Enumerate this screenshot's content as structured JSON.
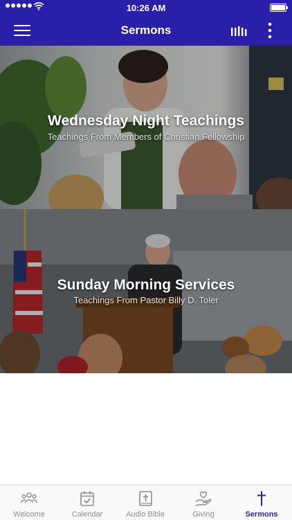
{
  "status_bar": {
    "time": "10:26 AM"
  },
  "header": {
    "title": "Sermons"
  },
  "cards": [
    {
      "title": "Wednesday Night Teachings",
      "subtitle": "Teachings From Members of Christian Fellowship"
    },
    {
      "title": "Sunday Morning Services",
      "subtitle": "Teachings From Pastor Billy D. Toler"
    }
  ],
  "tabs": [
    {
      "label": "Welcome",
      "icon": "people-icon"
    },
    {
      "label": "Calendar",
      "icon": "calendar-check-icon"
    },
    {
      "label": "Audio Bible",
      "icon": "bible-icon"
    },
    {
      "label": "Giving",
      "icon": "hand-heart-icon"
    },
    {
      "label": "Sermons",
      "icon": "cross-icon",
      "active": true
    }
  ],
  "colors": {
    "accent": "#2a1fa8",
    "tab_inactive": "#8e8e8e"
  }
}
